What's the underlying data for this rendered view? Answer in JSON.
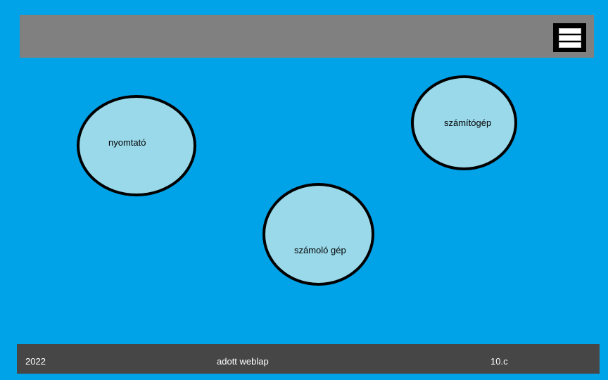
{
  "header": {
    "menu_icon": "hamburger-menu-icon"
  },
  "bubbles": [
    {
      "label": "nyomtató"
    },
    {
      "label": "számítógép"
    },
    {
      "label": "számoló gép"
    }
  ],
  "footer": {
    "year": "2022",
    "title": "adott weblap",
    "class": "10.c"
  },
  "colors": {
    "background": "#00a2e8",
    "header": "#808080",
    "bubble_fill": "#99d9ea",
    "bubble_border": "#000000",
    "footer": "#464646"
  }
}
